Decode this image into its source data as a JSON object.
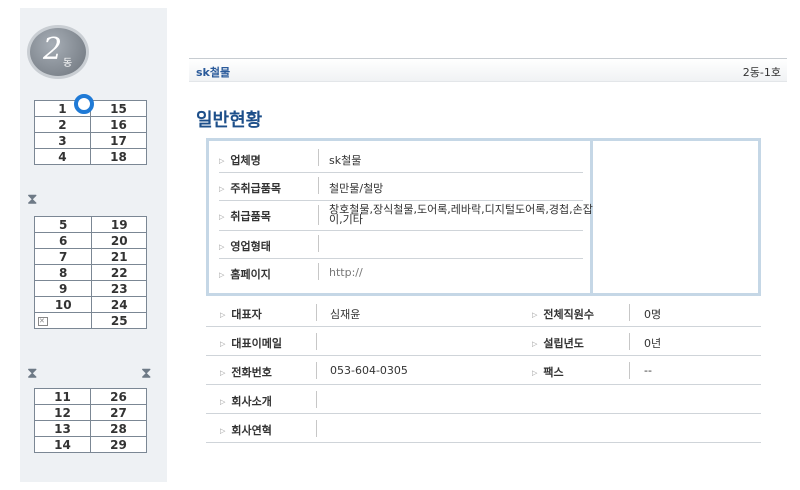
{
  "sidebar": {
    "badge_number": "2",
    "badge_unit": "동",
    "groups": [
      [
        [
          "1",
          "15"
        ],
        [
          "2",
          "16"
        ],
        [
          "3",
          "17"
        ],
        [
          "4",
          "18"
        ]
      ],
      [
        [
          "5",
          "19"
        ],
        [
          "6",
          "20"
        ],
        [
          "7",
          "21"
        ],
        [
          "8",
          "22"
        ],
        [
          "9",
          "23"
        ],
        [
          "10",
          "24"
        ],
        [
          "",
          "25"
        ]
      ],
      [
        [
          "11",
          "26"
        ],
        [
          "12",
          "27"
        ],
        [
          "13",
          "28"
        ],
        [
          "14",
          "29"
        ]
      ]
    ],
    "selected_unit": "1"
  },
  "header": {
    "company": "sk철물",
    "unit": "2동-1호"
  },
  "section": {
    "title": "일반현황"
  },
  "general": [
    {
      "label": "업체명",
      "value": "sk철물"
    },
    {
      "label": "주취급품목",
      "value": "철만물/철망"
    },
    {
      "label": "취급품목",
      "value": "창호철물,장식철물,도어록,레바락,디지털도어록,경첩,손잡이,기타"
    },
    {
      "label": "영업형태",
      "value": ""
    },
    {
      "label": "홈페이지",
      "value": "http://"
    }
  ],
  "details": [
    {
      "label1": "대표자",
      "value1": "심재윤",
      "label2": "전체직원수",
      "value2": "0명"
    },
    {
      "label1": "대표이메일",
      "value1": "",
      "label2": "설립년도",
      "value2": "0년"
    },
    {
      "label1": "전화번호",
      "value1": "053-604-0305",
      "label2": "팩스",
      "value2": "--"
    },
    {
      "label1": "회사소개",
      "value1": ""
    },
    {
      "label1": "회사연혁",
      "value1": ""
    }
  ],
  "icons": {
    "hourglass": "hourglass-icon",
    "arrow": "triangle-right-icon",
    "mail": "mail-icon"
  },
  "colors": {
    "accent": "#1d4f8a",
    "selected": "#1f7ad6",
    "box_border": "#c5d7e6"
  }
}
